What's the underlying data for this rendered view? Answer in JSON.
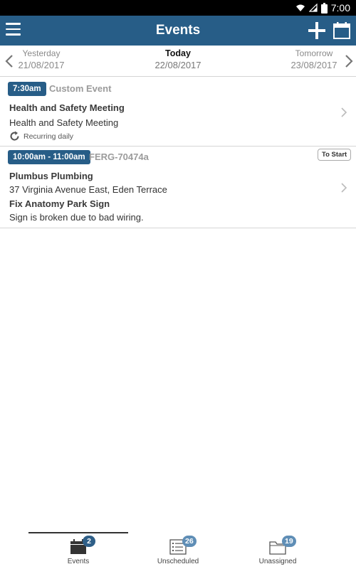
{
  "status_bar": {
    "time": "7:00"
  },
  "app_bar": {
    "title": "Events"
  },
  "date_nav": {
    "previous": {
      "label": "Yesterday",
      "date": "21/08/2017"
    },
    "current": {
      "label": "Today",
      "date": "22/08/2017"
    },
    "next": {
      "label": "Tomorrow",
      "date": "23/08/2017"
    }
  },
  "events": [
    {
      "time": "7:30am",
      "type": "Custom Event",
      "title": "Health and Safety Meeting",
      "description": "Health and Safety Meeting",
      "recurrence": "Recurring daily"
    },
    {
      "time": "10:00am - 11:00am",
      "job_id": "FERG-70474a",
      "status": "To Start",
      "client": "Plumbus Plumbing",
      "address": "37 Virginia Avenue East, Eden Terrace",
      "job_title": "Fix Anatomy Park Sign",
      "job_description": "Sign is broken due to bad wiring."
    }
  ],
  "bottom_nav": {
    "tabs": [
      {
        "label": "Events",
        "count": "2",
        "icon": "calendar-icon",
        "active": true
      },
      {
        "label": "Unscheduled",
        "count": "26",
        "icon": "checklist-icon",
        "active": false
      },
      {
        "label": "Unassigned",
        "count": "19",
        "icon": "folder-icon",
        "active": false
      }
    ]
  },
  "colors": {
    "primary": "#275d87",
    "badge_light": "#5f8eb6",
    "status_bar": "#000000"
  }
}
